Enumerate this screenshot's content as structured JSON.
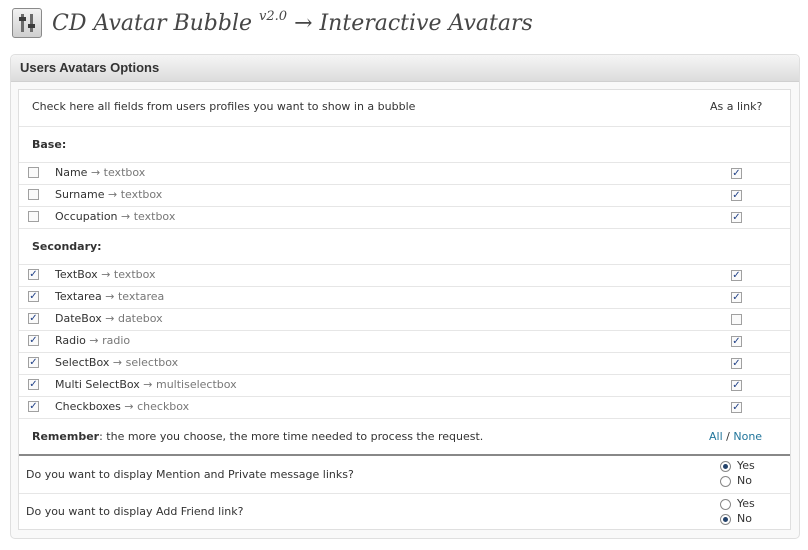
{
  "header": {
    "title": "CD Avatar Bubble",
    "version": "v2.0",
    "subtitle": "→ Interactive Avatars"
  },
  "panel": {
    "title": "Users Avatars Options"
  },
  "table": {
    "intro": "Check here all fields from users profiles you want to show in a bubble",
    "as_link_header": "As a link?",
    "base_label": "Base:",
    "secondary_label": "Secondary:",
    "base_fields": [
      {
        "name": "Name",
        "type": "→ textbox",
        "checked": false,
        "link": true
      },
      {
        "name": "Surname",
        "type": "→ textbox",
        "checked": false,
        "link": true
      },
      {
        "name": "Occupation",
        "type": "→ textbox",
        "checked": false,
        "link": true
      }
    ],
    "secondary_fields": [
      {
        "name": "TextBox",
        "type": "→ textbox",
        "checked": true,
        "link": true
      },
      {
        "name": "Textarea",
        "type": "→ textarea",
        "checked": true,
        "link": true
      },
      {
        "name": "DateBox",
        "type": "→ datebox",
        "checked": true,
        "link": false
      },
      {
        "name": "Radio",
        "type": "→ radio",
        "checked": true,
        "link": true
      },
      {
        "name": "SelectBox",
        "type": "→ selectbox",
        "checked": true,
        "link": true
      },
      {
        "name": "Multi SelectBox",
        "type": "→ multiselectbox",
        "checked": true,
        "link": true
      },
      {
        "name": "Checkboxes",
        "type": "→ checkbox",
        "checked": true,
        "link": true
      }
    ],
    "remember_bold": "Remember",
    "remember_text": ": the more you choose, the more time needed to process the request.",
    "all_label": "All",
    "slash": "/",
    "none_label": "None"
  },
  "questions": [
    {
      "text": "Do you want to display Mention and Private message links?",
      "yes": "Yes",
      "no": "No",
      "selected": "yes"
    },
    {
      "text": "Do you want to display Add Friend link?",
      "yes": "Yes",
      "no": "No",
      "selected": "no"
    }
  ]
}
